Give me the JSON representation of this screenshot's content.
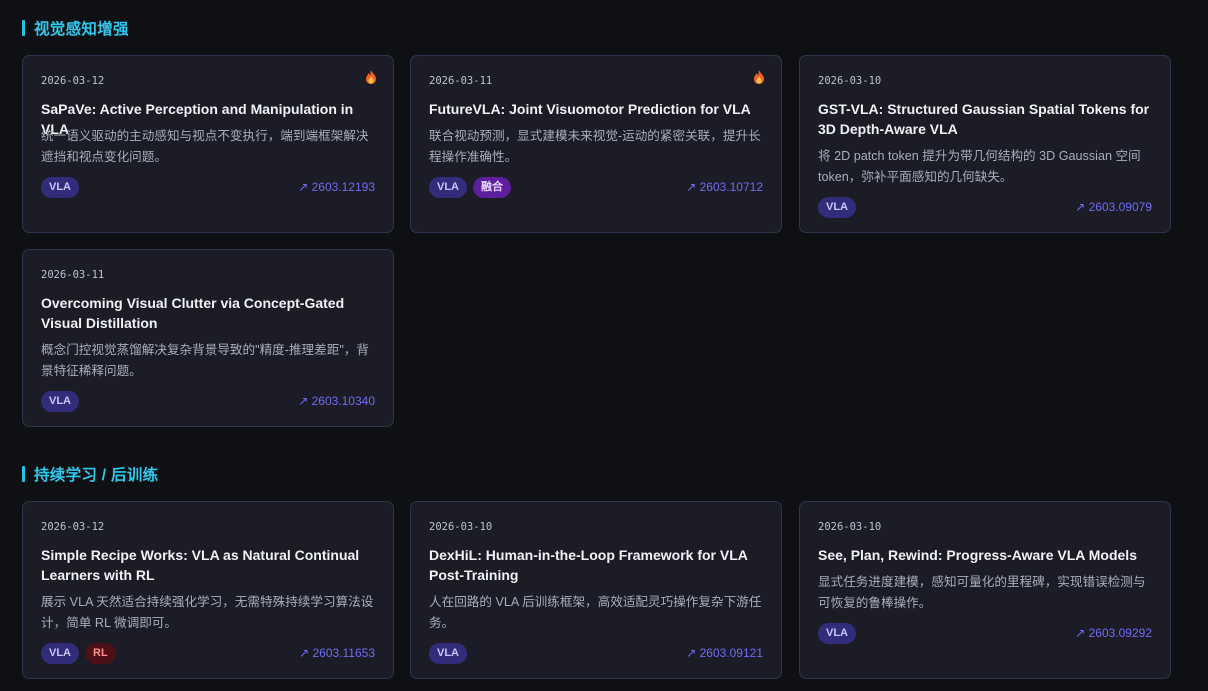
{
  "sections": [
    {
      "title": "视觉感知增强",
      "cards": [
        {
          "date": "2026-03-12",
          "hot": true,
          "title": "SaPaVe: Active Perception and Manipulation in VLA",
          "desc": "统一语义驱动的主动感知与视点不变执行，端到端框架解决遮挡和视点变化问题。",
          "tags": [
            "VLA"
          ],
          "link": "↗ 2603.12193"
        },
        {
          "date": "2026-03-11",
          "hot": true,
          "title": "FutureVLA: Joint Visuomotor Prediction for VLA",
          "desc": "联合视动预测，显式建模未来视觉-运动的紧密关联，提升长程操作准确性。",
          "tags": [
            "VLA",
            "融合"
          ],
          "link": "↗ 2603.10712"
        },
        {
          "date": "2026-03-10",
          "hot": false,
          "title": "GST-VLA: Structured Gaussian Spatial Tokens for 3D Depth-Aware VLA",
          "desc": "将 2D patch token 提升为带几何结构的 3D Gaussian 空间 token，弥补平面感知的几何缺失。",
          "tags": [
            "VLA"
          ],
          "link": "↗ 2603.09079"
        },
        {
          "date": "2026-03-11",
          "hot": false,
          "title": "Overcoming Visual Clutter via Concept-Gated Visual Distillation",
          "desc": "概念门控视觉蒸馏解决复杂背景导致的\"精度-推理差距\"，背景特征稀释问题。",
          "tags": [
            "VLA"
          ],
          "link": "↗ 2603.10340"
        }
      ]
    },
    {
      "title": "持续学习 / 后训练",
      "cards": [
        {
          "date": "2026-03-12",
          "hot": false,
          "title": "Simple Recipe Works: VLA as Natural Continual Learners with RL",
          "desc": "展示 VLA 天然适合持续强化学习，无需特殊持续学习算法设计，简单 RL 微调即可。",
          "tags": [
            "VLA",
            "RL"
          ],
          "link": "↗ 2603.11653"
        },
        {
          "date": "2026-03-10",
          "hot": false,
          "title": "DexHiL: Human-in-the-Loop Framework for VLA Post-Training",
          "desc": "人在回路的 VLA 后训练框架，高效适配灵巧操作复杂下游任务。",
          "tags": [
            "VLA"
          ],
          "link": "↗ 2603.09121"
        },
        {
          "date": "2026-03-10",
          "hot": false,
          "title": "See, Plan, Rewind: Progress-Aware VLA Models",
          "desc": "显式任务进度建模，感知可量化的里程碑，实现错误检测与可恢复的鲁棒操作。",
          "tags": [
            "VLA"
          ],
          "link": "↗ 2603.09292"
        }
      ]
    }
  ]
}
